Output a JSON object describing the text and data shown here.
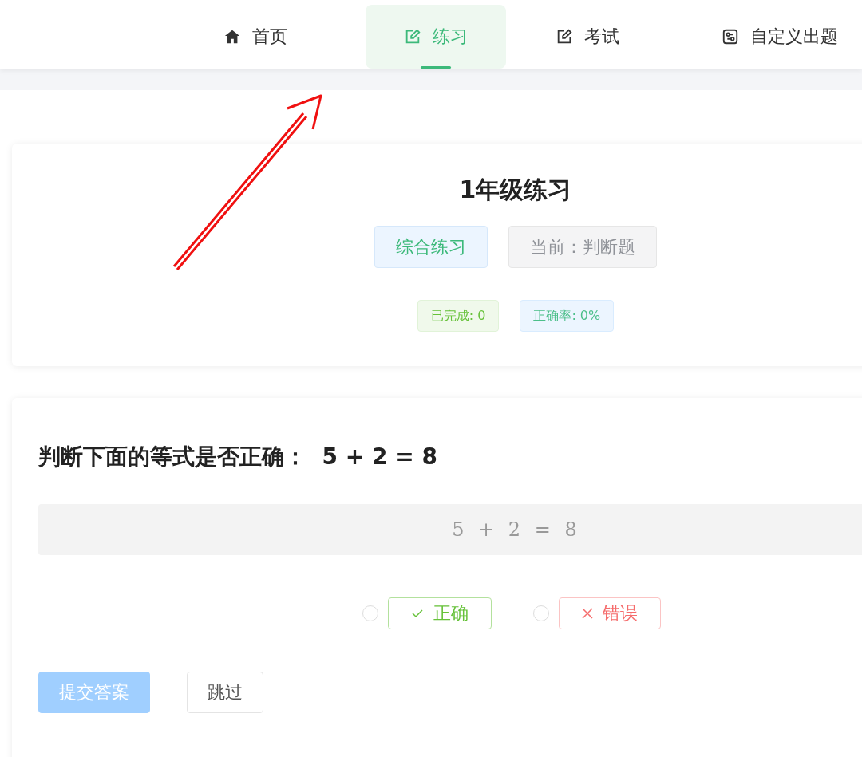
{
  "nav": {
    "items": [
      {
        "label": "首页",
        "kind": "home",
        "selected": false
      },
      {
        "label": "练习",
        "kind": "edit",
        "selected": true
      },
      {
        "label": "考试",
        "kind": "edit",
        "selected": false
      },
      {
        "label": "自定义出题",
        "kind": "settings",
        "selected": false
      }
    ]
  },
  "practice": {
    "title": "1年级练习",
    "mode_tag": "综合练习",
    "current_tag": "当前：判断题",
    "stats": [
      {
        "label": "已完成: 0",
        "color": "#67c23a"
      },
      {
        "label": "正确率: 0%",
        "color": "#4cbf8a"
      }
    ]
  },
  "question": {
    "prompt": "判断下面的等式是否正确：  5 + 2 = 8",
    "display": "5 + 2 = 8",
    "options": [
      {
        "label": "正确",
        "kind": "correct",
        "selected": false
      },
      {
        "label": "错误",
        "kind": "wrong",
        "selected": false
      }
    ]
  },
  "actions": [
    {
      "label": "提交答案",
      "kind": "primary",
      "disabled": true
    },
    {
      "label": "跳过",
      "kind": "plain",
      "disabled": false
    }
  ]
}
